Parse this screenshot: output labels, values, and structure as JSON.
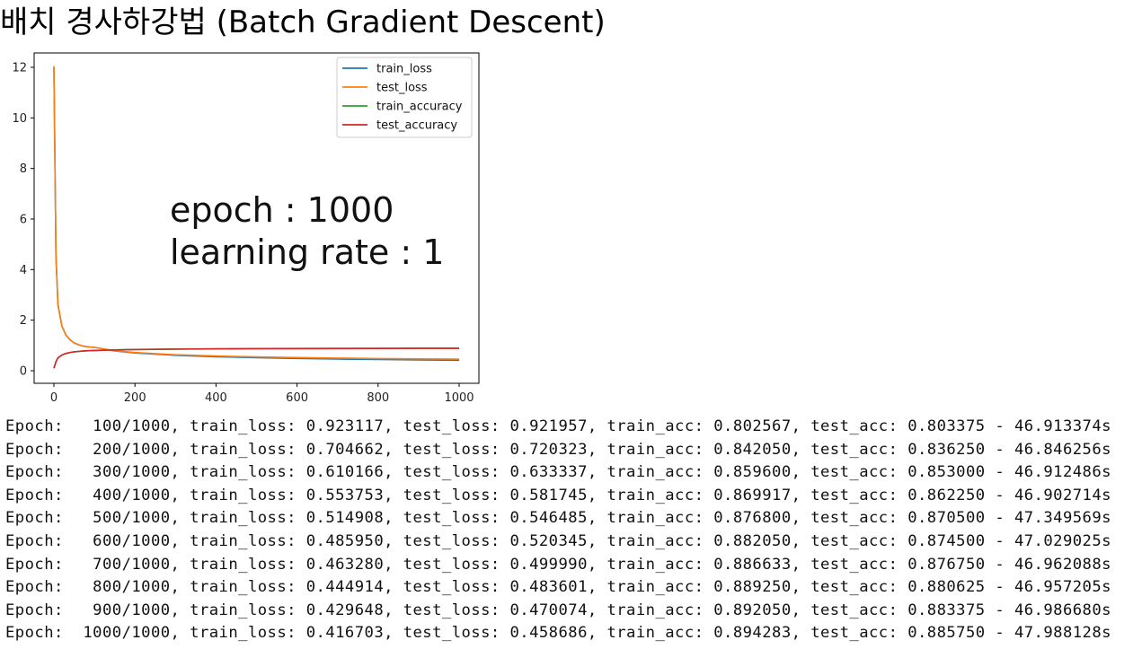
{
  "title": "배치 경사하강법 (Batch Gradient Descent)",
  "chart_data": {
    "type": "line",
    "xlim": [
      0,
      1000
    ],
    "ylim": [
      0,
      12
    ],
    "x_ticks": [
      "0",
      "200",
      "400",
      "600",
      "800",
      "1000"
    ],
    "y_ticks": [
      "0",
      "2",
      "4",
      "6",
      "8",
      "10",
      "12"
    ],
    "grid": false,
    "legend_position": "top-right",
    "annotations": [
      "epoch : 1000",
      "learning rate : 1"
    ],
    "series": [
      {
        "name": "train_loss",
        "color": "#1f77b4",
        "x": [
          0,
          5,
          10,
          20,
          30,
          40,
          50,
          60,
          70,
          80,
          90,
          100,
          150,
          200,
          300,
          400,
          500,
          600,
          700,
          800,
          900,
          1000
        ],
        "y": [
          12.0,
          4.5,
          2.6,
          1.75,
          1.4,
          1.22,
          1.1,
          1.03,
          0.98,
          0.95,
          0.935,
          0.923117,
          0.78,
          0.704662,
          0.610166,
          0.553753,
          0.514908,
          0.48595,
          0.46328,
          0.444914,
          0.429648,
          0.416703
        ]
      },
      {
        "name": "test_loss",
        "color": "#ff7f0e",
        "x": [
          0,
          5,
          10,
          20,
          30,
          40,
          50,
          60,
          70,
          80,
          90,
          100,
          150,
          200,
          300,
          400,
          500,
          600,
          700,
          800,
          900,
          1000
        ],
        "y": [
          12.05,
          4.55,
          2.62,
          1.76,
          1.41,
          1.225,
          1.105,
          1.035,
          0.985,
          0.955,
          0.935,
          0.921957,
          0.79,
          0.720323,
          0.633337,
          0.581745,
          0.546485,
          0.520345,
          0.49999,
          0.483601,
          0.470074,
          0.458686
        ]
      },
      {
        "name": "train_accuracy",
        "color": "#2ca02c",
        "x": [
          0,
          5,
          10,
          20,
          30,
          40,
          50,
          60,
          70,
          80,
          90,
          100,
          150,
          200,
          300,
          400,
          500,
          600,
          700,
          800,
          900,
          1000
        ],
        "y": [
          0.1,
          0.35,
          0.5,
          0.62,
          0.68,
          0.72,
          0.745,
          0.76,
          0.775,
          0.785,
          0.795,
          0.802567,
          0.825,
          0.84205,
          0.8596,
          0.869917,
          0.8768,
          0.88205,
          0.886633,
          0.88925,
          0.89205,
          0.894283
        ]
      },
      {
        "name": "test_accuracy",
        "color": "#d62728",
        "x": [
          0,
          5,
          10,
          20,
          30,
          40,
          50,
          60,
          70,
          80,
          90,
          100,
          150,
          200,
          300,
          400,
          500,
          600,
          700,
          800,
          900,
          1000
        ],
        "y": [
          0.1,
          0.36,
          0.51,
          0.625,
          0.685,
          0.725,
          0.75,
          0.765,
          0.78,
          0.79,
          0.797,
          0.803375,
          0.822,
          0.83625,
          0.853,
          0.86225,
          0.8705,
          0.8745,
          0.87675,
          0.880625,
          0.883375,
          0.88575
        ]
      }
    ]
  },
  "log_lines": [
    "Epoch:   100/1000, train_loss: 0.923117, test_loss: 0.921957, train_acc: 0.802567, test_acc: 0.803375 - 46.913374s",
    "Epoch:   200/1000, train_loss: 0.704662, test_loss: 0.720323, train_acc: 0.842050, test_acc: 0.836250 - 46.846256s",
    "Epoch:   300/1000, train_loss: 0.610166, test_loss: 0.633337, train_acc: 0.859600, test_acc: 0.853000 - 46.912486s",
    "Epoch:   400/1000, train_loss: 0.553753, test_loss: 0.581745, train_acc: 0.869917, test_acc: 0.862250 - 46.902714s",
    "Epoch:   500/1000, train_loss: 0.514908, test_loss: 0.546485, train_acc: 0.876800, test_acc: 0.870500 - 47.349569s",
    "Epoch:   600/1000, train_loss: 0.485950, test_loss: 0.520345, train_acc: 0.882050, test_acc: 0.874500 - 47.029025s",
    "Epoch:   700/1000, train_loss: 0.463280, test_loss: 0.499990, train_acc: 0.886633, test_acc: 0.876750 - 46.962088s",
    "Epoch:   800/1000, train_loss: 0.444914, test_loss: 0.483601, train_acc: 0.889250, test_acc: 0.880625 - 46.957205s",
    "Epoch:   900/1000, train_loss: 0.429648, test_loss: 0.470074, train_acc: 0.892050, test_acc: 0.883375 - 46.986680s",
    "Epoch:  1000/1000, train_loss: 0.416703, test_loss: 0.458686, train_acc: 0.894283, test_acc: 0.885750 - 47.988128s"
  ]
}
